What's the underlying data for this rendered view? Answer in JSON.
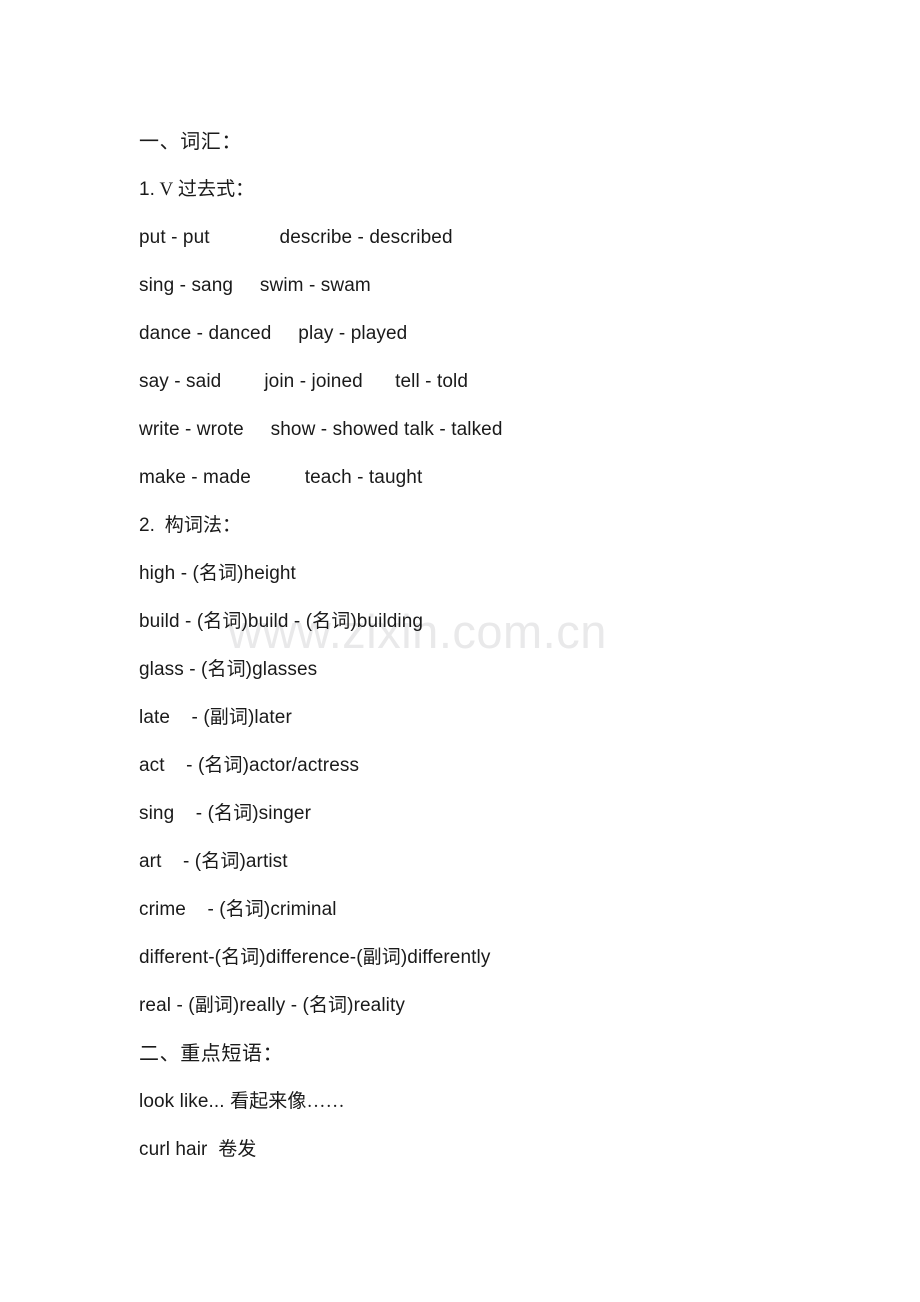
{
  "document": {
    "watermark": "www.zixin.com.cn",
    "watermark_color": "#e9e9ea",
    "text_color": "#1a1a1a",
    "background_color": "#ffffff",
    "sections": [
      {
        "id": "vocabulary",
        "heading": "一、词汇：",
        "subsections": [
          {
            "id": "past-tense",
            "number": "1.",
            "heading_rest": " V 过去式：",
            "lines": [
              "put - put             describe - described",
              "sing - sang     swim - swam",
              "dance - danced     play - played",
              "say - said        join - joined      tell - told",
              "write - wrote     show - showed talk - talked",
              "make - made          teach - taught"
            ]
          },
          {
            "id": "word-formation",
            "number": "2.",
            "heading_rest": "  构词法：",
            "entries": [
              {
                "base": "high - (",
                "pos": "名词",
                "result": ")height"
              },
              {
                "base": "build - (",
                "pos": "名词",
                "result": ")build - (",
                "pos2": "名词",
                "result2": ")building"
              },
              {
                "base": "glass - (",
                "pos": "名词",
                "result": ")glasses"
              },
              {
                "base": "late    - (",
                "pos": "副词",
                "result": ")later"
              },
              {
                "base": "act    - (",
                "pos": "名词",
                "result": ")actor/actress"
              },
              {
                "base": "sing    - (",
                "pos": "名词",
                "result": ")singer"
              },
              {
                "base": "art    - (",
                "pos": "名词",
                "result": ")artist"
              },
              {
                "base": "crime    - (",
                "pos": "名词",
                "result": ")criminal"
              },
              {
                "base": "different-(",
                "pos": "名词",
                "result": ")difference-(",
                "pos2": "副词",
                "result2": ")differently"
              },
              {
                "base": "real - (",
                "pos": "副词",
                "result": ")really - (",
                "pos2": "名词",
                "result2": ")reality"
              }
            ]
          }
        ]
      },
      {
        "id": "key-phrases",
        "heading": "二、重点短语：",
        "phrases": [
          {
            "english": "look like... ",
            "chinese": "看起来像……"
          },
          {
            "english": "curl hair  ",
            "chinese": "卷发"
          }
        ]
      }
    ]
  }
}
